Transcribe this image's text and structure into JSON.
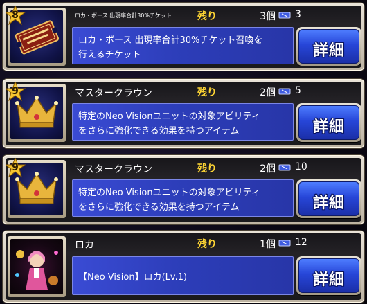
{
  "items": [
    {
      "rarity": "8",
      "name": "ロカ・ボース 出現率合計30%チケット",
      "remain_label": "残り",
      "count": "3個",
      "owned": "3",
      "desc1": "ロカ・ボース 出現率合計30%チケット召喚を",
      "desc2": "行えるチケット",
      "button": "詳細",
      "icon": "ticket-icon"
    },
    {
      "rarity": "9",
      "name": "マスタークラウン",
      "remain_label": "残り",
      "count": "2個",
      "owned": "5",
      "desc1": "特定のNeo Visionユニットの対象アビリティ",
      "desc2": "をさらに強化できる効果を持つアイテム",
      "button": "詳細",
      "icon": "crown-icon"
    },
    {
      "rarity": "9",
      "name": "マスタークラウン",
      "remain_label": "残り",
      "count": "2個",
      "owned": "10",
      "desc1": "特定のNeo Visionユニットの対象アビリティ",
      "desc2": "をさらに強化できる効果を持つアイテム",
      "button": "詳細",
      "icon": "crown-icon"
    },
    {
      "name": "ロカ",
      "remain_label": "残り",
      "count": "1個",
      "owned": "12",
      "desc1": "【Neo Vision】ロカ(Lv.1)",
      "button": "詳細",
      "icon": "character-portrait"
    }
  ],
  "colors": {
    "remain": "#ffd634",
    "desc_bg": "#2c3db8",
    "button_blue": "#2746d8"
  }
}
